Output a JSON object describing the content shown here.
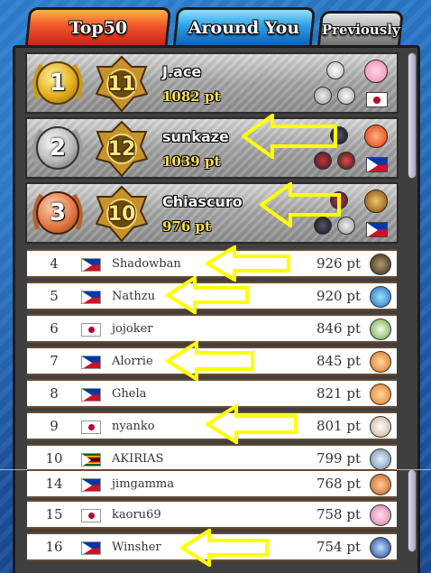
{
  "tabs": [
    {
      "label": "Top50",
      "active": true
    },
    {
      "label": "Around You",
      "active": false
    },
    {
      "label": "Previously",
      "active": false
    }
  ],
  "podium": [
    {
      "rank": "1",
      "level": "11",
      "name": "J.ace",
      "points": "1082 pt",
      "medal": "gold",
      "flag": "japan-flag-icon"
    },
    {
      "rank": "2",
      "level": "12",
      "name": "sunkaze",
      "points": "1039 pt",
      "medal": "silver",
      "flag": "philippines-flag-icon"
    },
    {
      "rank": "3",
      "level": "10",
      "name": "Chiascuro",
      "points": "976 pt",
      "medal": "bronze",
      "flag": "philippines-flag-icon"
    }
  ],
  "rows": [
    {
      "rank": "4",
      "name": "Shadowban",
      "points": "926 pt",
      "flag": "philippines-flag-icon",
      "avatar": "dark-bird-avatar-icon"
    },
    {
      "rank": "5",
      "name": "Nathzu",
      "points": "920 pt",
      "flag": "philippines-flag-icon",
      "avatar": "blue-globe-avatar-icon"
    },
    {
      "rank": "6",
      "name": "jojoker",
      "points": "846 pt",
      "flag": "japan-flag-icon",
      "avatar": "green-leaf-avatar-icon"
    },
    {
      "rank": "7",
      "name": "Alorrie",
      "points": "845 pt",
      "flag": "philippines-flag-icon",
      "avatar": "tiger-avatar-icon"
    },
    {
      "rank": "8",
      "name": "Ghela",
      "points": "821 pt",
      "flag": "philippines-flag-icon",
      "avatar": "tiger-avatar-icon"
    },
    {
      "rank": "9",
      "name": "nyanko",
      "points": "801 pt",
      "flag": "japan-flag-icon",
      "avatar": "cat-avatar-icon"
    },
    {
      "rank": "10",
      "name": "AKIRIAS",
      "points": "799 pt",
      "flag": "zimbabwe-flag-icon",
      "avatar": "ice-orb-avatar-icon"
    },
    {
      "rank": "14",
      "name": "jimgamma",
      "points": "768 pt",
      "flag": "philippines-flag-icon",
      "avatar": "fox-avatar-icon"
    },
    {
      "rank": "15",
      "name": "kaoru69",
      "points": "758 pt",
      "flag": "japan-flag-icon",
      "avatar": "pink-flower-avatar-icon"
    },
    {
      "rank": "16",
      "name": "Winsher",
      "points": "754 pt",
      "flag": "philippines-flag-icon",
      "avatar": "blue-hero-avatar-icon"
    }
  ],
  "colors": {
    "annotation_arrow": "#ffff00",
    "points_gold": "#ffe14d",
    "row_border": "#6a4a30"
  }
}
